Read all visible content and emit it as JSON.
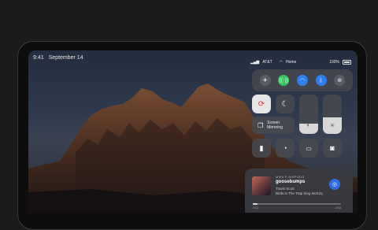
{
  "status_bar": {
    "time": "9:41",
    "date": "September 14"
  },
  "control_center": {
    "status": {
      "carrier": "AT&T",
      "network": "Home",
      "battery": "100%"
    },
    "connectivity": [
      {
        "name": "airplane-mode",
        "icon": "airplane-icon",
        "active": false,
        "color": "#5a5c63"
      },
      {
        "name": "cellular-data",
        "icon": "cellular-icon",
        "active": true,
        "color": "#32c65a"
      },
      {
        "name": "wifi",
        "icon": "wifi-icon",
        "active": true,
        "color": "#2f7ff0"
      },
      {
        "name": "bluetooth",
        "icon": "bluetooth-icon",
        "active": true,
        "color": "#2f7ff0"
      },
      {
        "name": "airdrop",
        "icon": "airdrop-icon",
        "active": false,
        "color": "#5a5c63"
      }
    ],
    "screen_mirroring_label": "Screen\nMirroring",
    "volume_level": 0.27,
    "brightness_level": 0.42
  },
  "now_playing": {
    "source": "MIKE'S AIRPODS",
    "title": "goosebumps",
    "artist": "Travis Scott",
    "album": "Birds in The Trap Sing McKnight",
    "time_elapsed": "0:12",
    "time_remaining": "-4:03",
    "progress": 0.05
  }
}
